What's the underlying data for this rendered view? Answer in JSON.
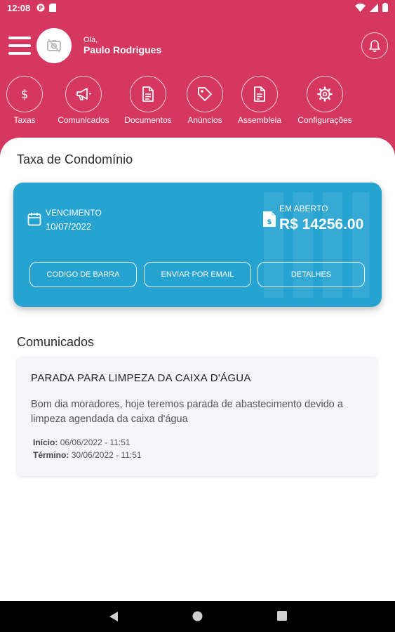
{
  "status_bar": {
    "time": "12:08"
  },
  "header": {
    "greeting": "Olá,",
    "user_name": "Paulo Rodrigues"
  },
  "nav": [
    {
      "label": "Taxas",
      "icon": "dollar-icon"
    },
    {
      "label": "Comunicados",
      "icon": "megaphone-icon"
    },
    {
      "label": "Documentos",
      "icon": "document-icon"
    },
    {
      "label": "Anúncios",
      "icon": "tag-icon"
    },
    {
      "label": "Assembleia",
      "icon": "document-list-icon"
    },
    {
      "label": "Configurações",
      "icon": "gear-icon"
    }
  ],
  "fee_section": {
    "title": "Taxa de Condomínio",
    "due_label": "VENCIMENTO",
    "due_date": "10/07/2022",
    "open_label": "EM ABERTO",
    "open_amount": "R$ 14256.00",
    "buttons": {
      "barcode": "CODIGO DE BARRA",
      "email": "ENVIAR POR EMAIL",
      "details": "DETALHES"
    }
  },
  "notices_section": {
    "title": "Comunicados",
    "items": [
      {
        "title": "PARADA PARA LIMPEZA DA CAIXA D'ÁGUA",
        "body": "Bom dia moradores, hoje teremos parada de abastecimento devido a limpeza agendada da caixa d'água",
        "start_label": "Início:",
        "start_value": "06/06/2022 - 11:51",
        "end_label": "Término:",
        "end_value": "30/06/2022 - 11:51"
      }
    ]
  },
  "colors": {
    "brand": "#d6375f",
    "card": "#27a3d1"
  }
}
